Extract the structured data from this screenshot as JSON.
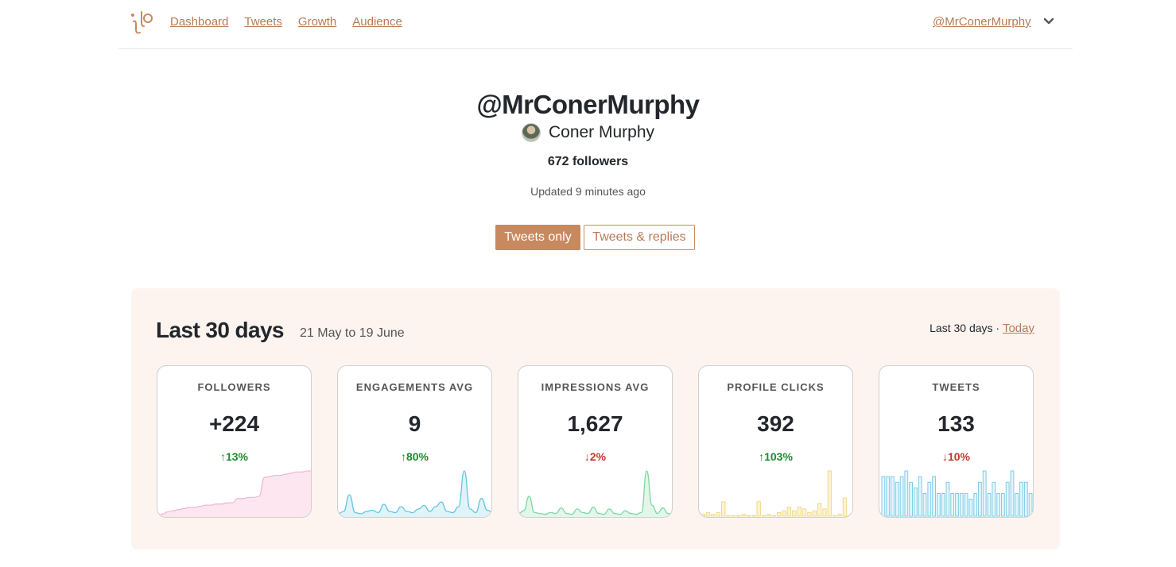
{
  "nav": {
    "links": [
      "Dashboard",
      "Tweets",
      "Growth",
      "Audience"
    ],
    "user": "@MrConerMurphy"
  },
  "profile": {
    "handle": "@MrConerMurphy",
    "name": "Coner Murphy",
    "followers": "672 followers",
    "updated": "Updated 9 minutes ago"
  },
  "toggle": {
    "active": "Tweets only",
    "inactive": "Tweets & replies"
  },
  "panel": {
    "title": "Last 30 days",
    "range": "21 May to 19 June",
    "period_label": "Last 30 days · ",
    "today_link": "Today"
  },
  "colors": {
    "accent": "#c8895f",
    "link": "#b77a55",
    "panel_bg": "#fdf4ef",
    "up": "#1f8a2e",
    "down": "#c0392b"
  },
  "cards": [
    {
      "label": "FOLLOWERS",
      "value": "+224",
      "change": "↑13%",
      "trend": "up",
      "chart": "area",
      "color": "#f2b8d3",
      "fill": "#fde6f0",
      "series": [
        0,
        2,
        4,
        5,
        6,
        7,
        8,
        8,
        9,
        10,
        10,
        11,
        11,
        12,
        12,
        16,
        16,
        17,
        17,
        18,
        35,
        36,
        37,
        37,
        38,
        39,
        40,
        40,
        41,
        41
      ]
    },
    {
      "label": "ENGAGEMENTS AVG",
      "value": "9",
      "change": "↑80%",
      "trend": "up",
      "chart": "line",
      "color": "#62c6e0",
      "fill": "#dff3f9",
      "series": [
        2,
        4,
        18,
        3,
        2,
        4,
        5,
        3,
        10,
        4,
        3,
        8,
        4,
        3,
        6,
        9,
        4,
        8,
        12,
        4,
        3,
        8,
        38,
        6,
        3,
        15,
        5,
        3
      ]
    },
    {
      "label": "IMPRESSIONS AVG",
      "value": "1,627",
      "change": "↓2%",
      "trend": "down",
      "chart": "line",
      "color": "#7dd8a3",
      "fill": "#e2f7ea",
      "series": [
        3,
        6,
        22,
        4,
        3,
        2,
        4,
        3,
        9,
        3,
        2,
        8,
        4,
        3,
        10,
        3,
        2,
        8,
        3,
        2,
        6,
        3,
        2,
        4,
        50,
        12,
        3,
        9,
        3,
        2
      ]
    },
    {
      "label": "PROFILE CLICKS",
      "value": "392",
      "change": "↑103%",
      "trend": "up",
      "chart": "bar",
      "color": "#f2d98a",
      "fill": "#fcf3d6",
      "series": [
        2,
        4,
        2,
        4,
        16,
        0,
        0,
        0,
        2,
        0,
        0,
        16,
        0,
        2,
        0,
        4,
        6,
        10,
        6,
        10,
        8,
        4,
        6,
        14,
        8,
        50,
        0,
        2,
        20,
        0
      ]
    },
    {
      "label": "TWEETS",
      "value": "133",
      "change": "↓10%",
      "trend": "down",
      "chart": "bar",
      "color": "#7fcde6",
      "fill": "#e4f5fb",
      "series": [
        7,
        7,
        7,
        6,
        7,
        8,
        6,
        5,
        7,
        4,
        6,
        7,
        4,
        4,
        6,
        4,
        4,
        4,
        4,
        3,
        4,
        6,
        8,
        4,
        6,
        4,
        4,
        6,
        8,
        4,
        6,
        6,
        4
      ]
    }
  ]
}
